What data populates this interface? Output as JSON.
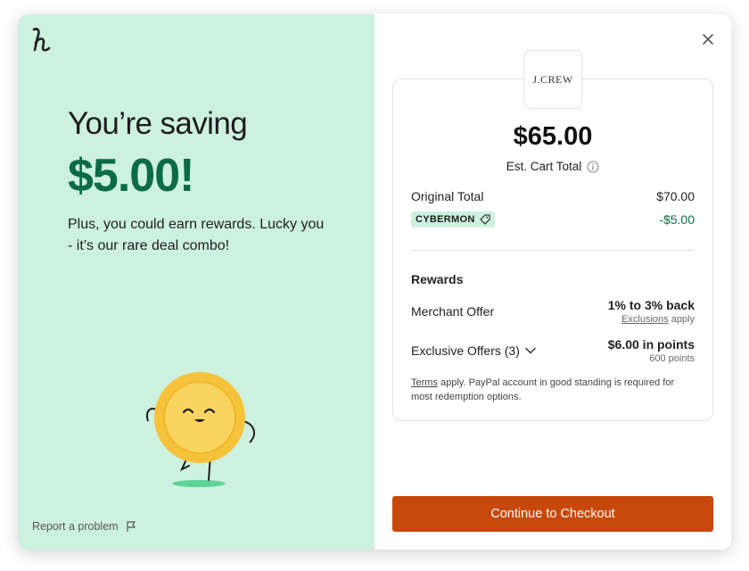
{
  "left": {
    "headline": "You’re saving",
    "amount": "$5.00!",
    "subtext": "Plus, you could earn rewards. Lucky you - it’s our rare deal combo!",
    "report_label": "Report a problem"
  },
  "merchant": {
    "logo_text": "J.CREW"
  },
  "cart": {
    "total": "$65.00",
    "total_label": "Est. Cart Total",
    "original_label": "Original Total",
    "original_value": "$70.00",
    "coupon_code": "CYBERMON",
    "discount_value": "-$5.00"
  },
  "rewards": {
    "heading": "Rewards",
    "merchant_offer_label": "Merchant Offer",
    "merchant_offer_value": "1% to 3% back",
    "exclusions_link": "Exclusions",
    "exclusions_suffix": " apply",
    "exclusive_label": "Exclusive Offers (3)",
    "exclusive_value": "$6.00 in points",
    "exclusive_points": "600 points"
  },
  "terms": {
    "link": "Terms",
    "text": " apply. PayPal account in good standing is required for most redemption options."
  },
  "cta_label": "Continue to Checkout",
  "colors": {
    "accent_green": "#0b6b45",
    "panel_mint": "#cdf1df",
    "cta_orange": "#c8480b"
  },
  "icons": [
    "honey-logo-icon",
    "close-icon",
    "info-icon",
    "tag-icon",
    "chevron-down-icon",
    "flag-icon",
    "coin-mascot-icon"
  ]
}
